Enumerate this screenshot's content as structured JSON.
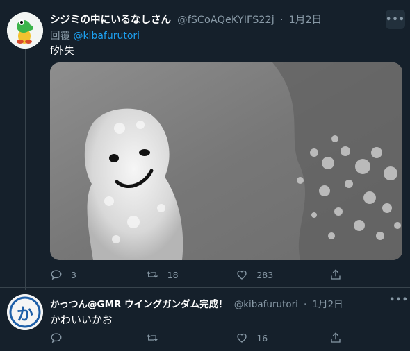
{
  "tweet1": {
    "display_name": "シジミの中にいるなしさん",
    "handle": "@fSCoAQeKYIFS22j",
    "dot": "·",
    "date": "1月2日",
    "reply_prefix": "回覆",
    "reply_to": "@kibafurutori",
    "text": "f外失",
    "more": "•••",
    "reply_count": "3",
    "retweet_count": "18",
    "like_count": "283"
  },
  "tweet2": {
    "display_name": "かっつん@GMR ウイングガンダム完成！",
    "handle": "@kibafurutori",
    "dot": "·",
    "date": "1月2日",
    "text": "かわいいかお",
    "more": "•••",
    "reply_count": "",
    "retweet_count": "",
    "like_count": "16",
    "avatar_glyph": "か"
  },
  "colors": {
    "background": "#15202b",
    "muted": "#8899a6",
    "link": "#1da1f2",
    "divider": "#38444d"
  },
  "icons": [
    "reply-icon",
    "retweet-icon",
    "like-icon",
    "share-icon",
    "more-icon"
  ]
}
